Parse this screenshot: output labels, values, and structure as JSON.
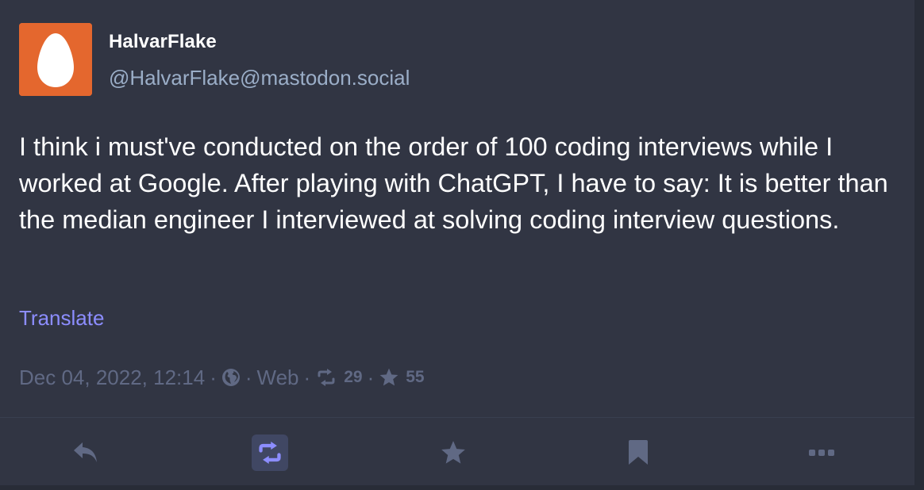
{
  "post": {
    "author": {
      "display_name": "HalvarFlake",
      "handle": "@HalvarFlake@mastodon.social",
      "avatar_icon": "egg-avatar-icon",
      "avatar_color": "#e4672e"
    },
    "content": "I think i must've conducted on the order of 100 coding interviews while I worked at Google. After playing with ChatGPT, I have to say: It is better than the median engineer I interviewed at solving coding interview questions.",
    "translate_label": "Translate",
    "meta": {
      "timestamp": "Dec 04, 2022, 12:14",
      "separator": "·",
      "visibility_icon": "globe-icon",
      "application": "Web",
      "reblogs_count": "29",
      "favourites_count": "55"
    }
  },
  "action_bar": {
    "reply_icon": "reply-icon",
    "boost_icon": "retweet-icon",
    "boost_active": true,
    "favourite_icon": "star-icon",
    "bookmark_icon": "bookmark-icon",
    "more_icon": "ellipsis-icon"
  },
  "colors": {
    "background": "#313543",
    "text": "#ffffff",
    "handle": "#9baec8",
    "link": "#8c8dff",
    "meta": "#606984",
    "boost_active": "#8c8dff"
  }
}
